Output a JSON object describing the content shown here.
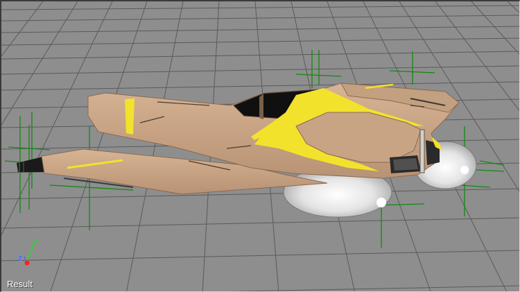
{
  "viewport": {
    "label": "Result",
    "background_color": "#8e8e8e",
    "grid_color": "#5c5c5c",
    "gizmo_color": "#0f8a0f"
  },
  "axis_gizmo": {
    "y_label": "Y",
    "z_label": "Z",
    "x_color": "#ff2020",
    "y_color": "#22e022",
    "z_color": "#4a6cff"
  },
  "model": {
    "name": "hover-vehicle",
    "hull_color": "#c9a584",
    "stripe_color": "#f3e22c",
    "hover_pad_color": "#e8e8e8",
    "cockpit_color": "#101010"
  }
}
